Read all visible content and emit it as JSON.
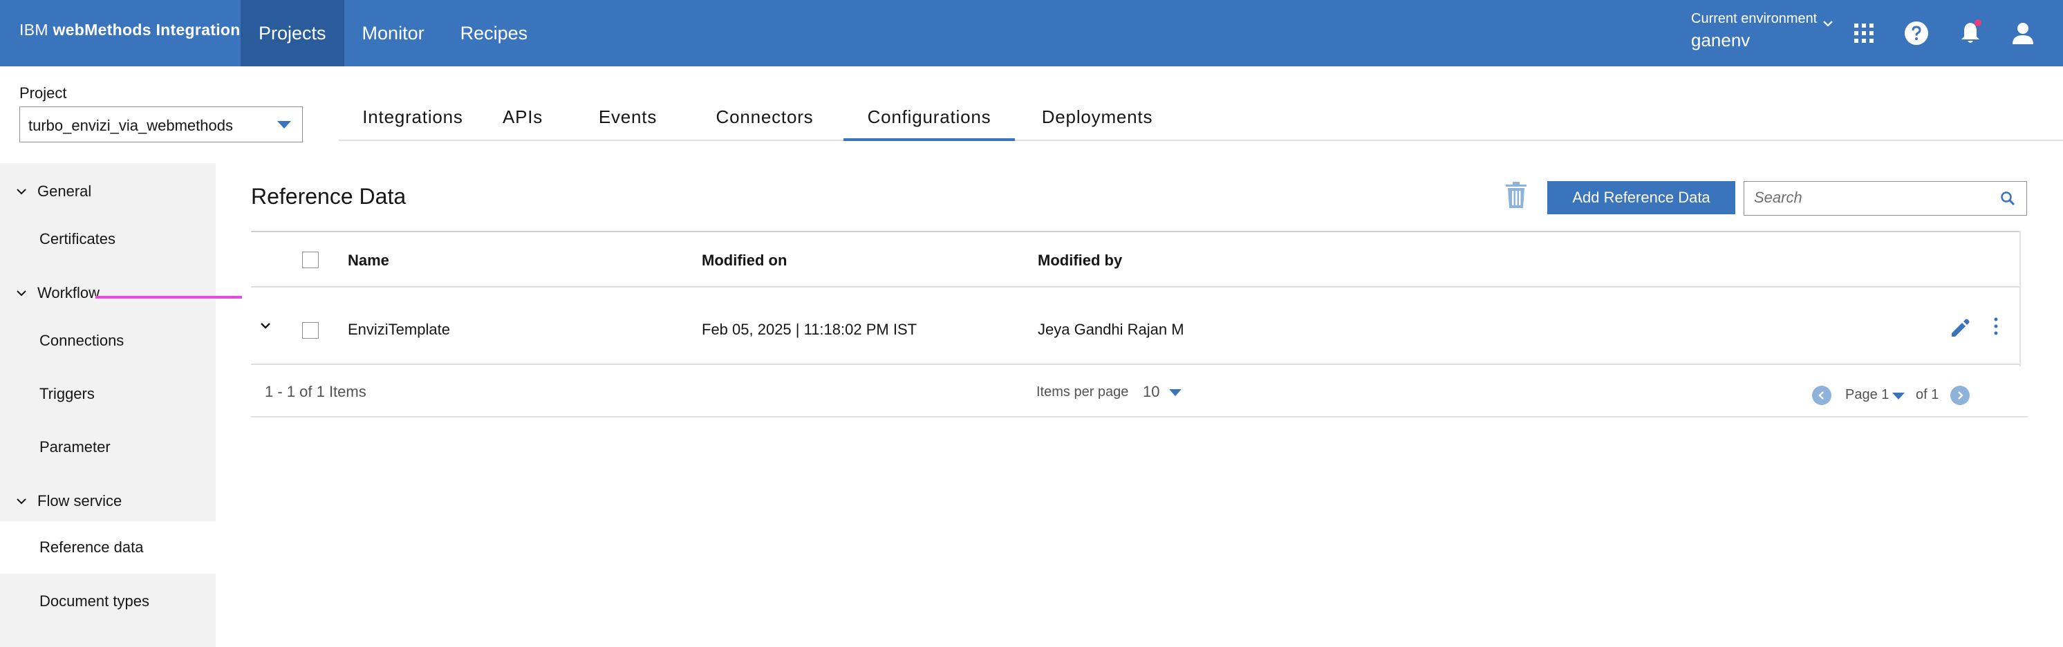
{
  "app": {
    "brand_prefix": "IBM",
    "brand_name": "webMethods Integration",
    "nav": [
      "Projects",
      "Monitor",
      "Recipes"
    ],
    "active_nav": "Projects",
    "environment_label": "Current environment",
    "environment_value": "ganenv",
    "icons": [
      "chevron-down-icon",
      "app-switcher-icon",
      "help-icon",
      "notification-icon",
      "user-icon"
    ],
    "colors": {
      "header": "#3a74bd",
      "header_active": "#2a5c9c",
      "notification_dot": "#e8407a"
    }
  },
  "project": {
    "label": "Project",
    "selected": "turbo_envizi_via_webmethods"
  },
  "tabs": [
    "Integrations",
    "APIs",
    "Events",
    "Connectors",
    "Configurations",
    "Deployments"
  ],
  "active_tab": "Configurations",
  "sidebar": {
    "groups": [
      {
        "label": "General",
        "items": [
          "Certificates"
        ]
      },
      {
        "label": "Workflow",
        "items": [
          "Connections",
          "Triggers",
          "Parameter"
        ]
      },
      {
        "label": "Flow service",
        "items": [
          "Reference data",
          "Document types"
        ]
      }
    ],
    "active_item": "Reference data"
  },
  "main": {
    "title": "Reference Data",
    "add_button": "Add Reference Data",
    "search_placeholder": "Search",
    "columns": [
      "Name",
      "Modified on",
      "Modified by"
    ],
    "rows": [
      {
        "name": "EnviziTemplate",
        "modified_on": "Feb 05, 2025 | 11:18:02 PM IST",
        "modified_by": "Jeya Gandhi Rajan M"
      }
    ],
    "pagination": {
      "count_text": "1 - 1 of 1 Items",
      "items_per_page_label": "Items per page",
      "items_per_page": "10",
      "page_label": "Page 1",
      "of_label": "of 1"
    }
  }
}
